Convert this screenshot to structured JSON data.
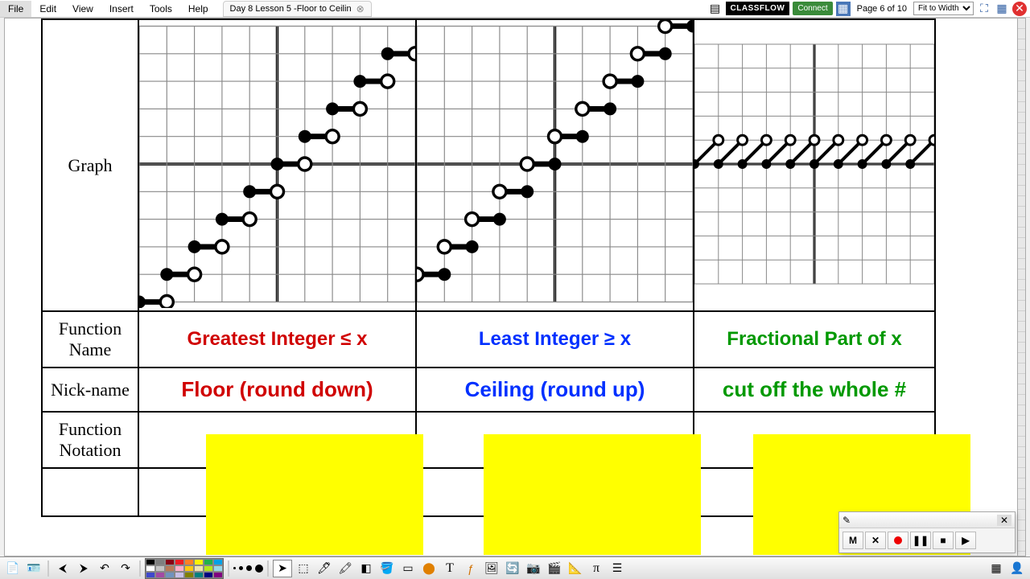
{
  "menu": {
    "items": [
      "File",
      "Edit",
      "View",
      "Insert",
      "Tools",
      "Help"
    ]
  },
  "document": {
    "tab_title": "Day 8 Lesson 5 -Floor to Ceilin"
  },
  "header": {
    "classflow": "CLASSFLOW",
    "connect": "Connect",
    "page_info": "Page 6 of 10",
    "zoom": "Fit to Width"
  },
  "table": {
    "row_labels": {
      "graph": "Graph",
      "name": "Function Name",
      "nick": "Nick-name",
      "notation": "Function Notation"
    },
    "cols": [
      {
        "name": "Greatest Integer ≤ x",
        "nick": "Floor (round down)",
        "color": "red"
      },
      {
        "name": "Least Integer ≥ x",
        "nick": "Ceiling (round up)",
        "color": "blue"
      },
      {
        "name": "Fractional Part of x",
        "nick": "cut off the whole #",
        "color": "green"
      }
    ]
  },
  "recorder": {
    "buttons": [
      "M",
      "✕",
      "●",
      "❚❚",
      "■",
      "▶"
    ]
  },
  "palette_colors": [
    "#000000",
    "#7f7f7f",
    "#880015",
    "#ed1c24",
    "#ff7f27",
    "#fff200",
    "#22b14c",
    "#00a2e8",
    "#ffffff",
    "#c3c3c3",
    "#b97a57",
    "#ffaec9",
    "#ffc90e",
    "#efe4b0",
    "#b5e61d",
    "#99d9ea",
    "#3f48cc",
    "#a349a4",
    "#7092be",
    "#c8bfe7",
    "#808000",
    "#008080",
    "#000080",
    "#800080"
  ],
  "chart_data": [
    {
      "type": "step",
      "name": "floor",
      "x_range": [
        -5,
        5
      ],
      "y_range": [
        -5,
        5
      ],
      "steps": [
        [
          -5,
          -5
        ],
        [
          -4,
          -4
        ],
        [
          -3,
          -3
        ],
        [
          -2,
          -2
        ],
        [
          -1,
          -1
        ],
        [
          0,
          0
        ],
        [
          1,
          1
        ],
        [
          2,
          2
        ],
        [
          3,
          3
        ],
        [
          4,
          4
        ]
      ],
      "closed": "left",
      "title": "Greatest Integer ≤ x"
    },
    {
      "type": "step",
      "name": "ceiling",
      "x_range": [
        -5,
        5
      ],
      "y_range": [
        -5,
        5
      ],
      "steps": [
        [
          -5,
          -4
        ],
        [
          -4,
          -3
        ],
        [
          -3,
          -2
        ],
        [
          -2,
          -1
        ],
        [
          -1,
          0
        ],
        [
          0,
          1
        ],
        [
          1,
          2
        ],
        [
          2,
          3
        ],
        [
          3,
          4
        ],
        [
          4,
          5
        ]
      ],
      "closed": "right",
      "title": "Least Integer ≥ x"
    },
    {
      "type": "sawtooth",
      "name": "fractional",
      "x_range": [
        -5,
        5
      ],
      "y_range": [
        -5,
        5
      ],
      "period": 1,
      "y_from": 0,
      "y_to": 1,
      "closed": "left",
      "title": "Fractional Part of x"
    }
  ]
}
